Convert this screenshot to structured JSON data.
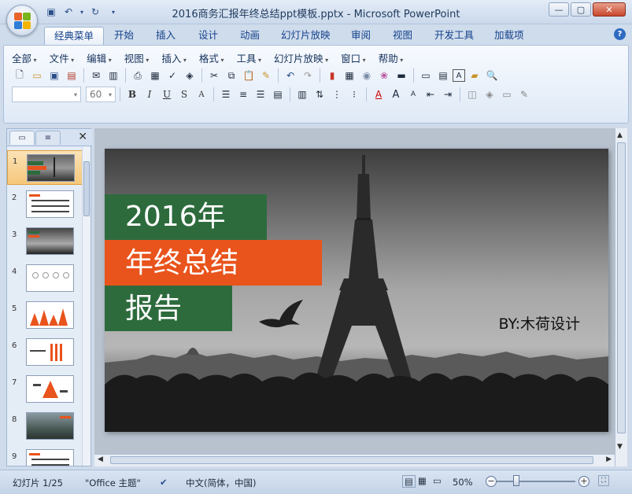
{
  "window": {
    "title": "2016商务汇报年终总结ppt模板.pptx - Microsoft PowerPoint",
    "minimize": "—",
    "maximize": "▢",
    "close": "✕"
  },
  "tabs": [
    {
      "label": "经典菜单",
      "active": true
    },
    {
      "label": "开始"
    },
    {
      "label": "插入"
    },
    {
      "label": "设计"
    },
    {
      "label": "动画"
    },
    {
      "label": "幻灯片放映"
    },
    {
      "label": "审阅"
    },
    {
      "label": "视图"
    },
    {
      "label": "开发工具"
    },
    {
      "label": "加载项"
    }
  ],
  "menu": [
    "全部",
    "文件",
    "编辑",
    "视图",
    "插入",
    "格式",
    "工具",
    "幻灯片放映",
    "窗口",
    "帮助"
  ],
  "format": {
    "font_size": "60",
    "bold": "B",
    "italic": "I",
    "underline": "U",
    "shadow": "S",
    "font_aa": "A"
  },
  "slide_panel": {
    "close": "✕",
    "slides": [
      {
        "num": "1",
        "selected": true
      },
      {
        "num": "2"
      },
      {
        "num": "3"
      },
      {
        "num": "4"
      },
      {
        "num": "5"
      },
      {
        "num": "6"
      },
      {
        "num": "7"
      },
      {
        "num": "8"
      },
      {
        "num": "9"
      }
    ]
  },
  "slide": {
    "line1": "2016年",
    "line2": "年终总结",
    "line3": "报告",
    "byline": "BY:木荷设计",
    "colors": {
      "green": "#2d6b3d",
      "orange": "#e9531c"
    }
  },
  "status": {
    "slide_count": "幻灯片 1/25",
    "theme": "\"Office 主题\"",
    "language": "中文(简体，中国)",
    "zoom": "50%",
    "zoom_out": "−",
    "zoom_in": "+"
  }
}
